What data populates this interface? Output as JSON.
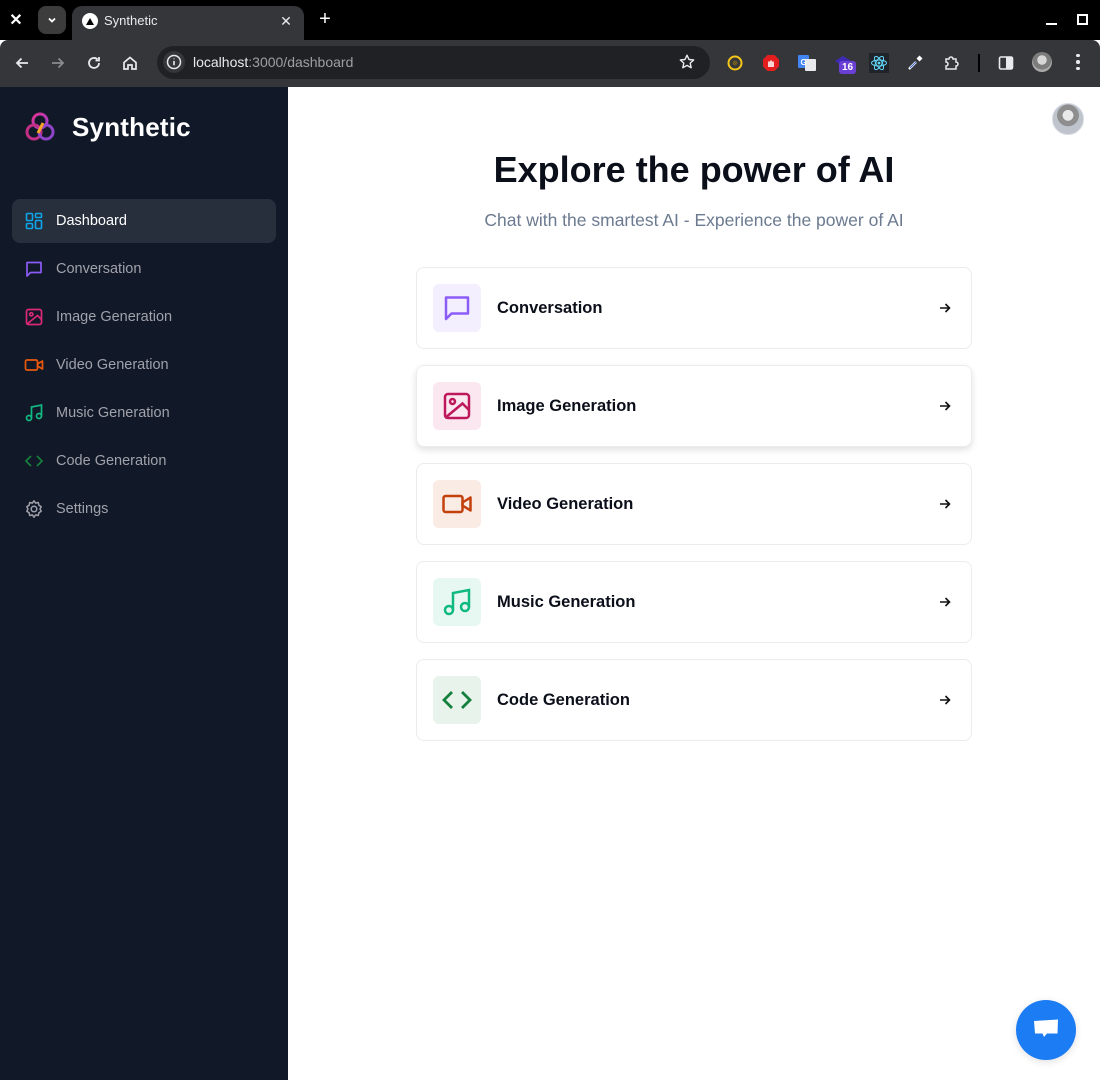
{
  "browser": {
    "tab_title": "Synthetic",
    "url_host": "localhost",
    "url_path": ":3000/dashboard",
    "extension_badge": "16"
  },
  "sidebar": {
    "brand_name": "Synthetic",
    "items": [
      {
        "label": "Dashboard",
        "icon": "layout-dashboard-icon",
        "color": "#0ea5e9",
        "active": true
      },
      {
        "label": "Conversation",
        "icon": "message-square-icon",
        "color": "#8b5cf6",
        "active": false
      },
      {
        "label": "Image Generation",
        "icon": "image-icon",
        "color": "#db2777",
        "active": false
      },
      {
        "label": "Video Generation",
        "icon": "video-icon",
        "color": "#ea580c",
        "active": false
      },
      {
        "label": "Music Generation",
        "icon": "music-icon",
        "color": "#10b981",
        "active": false
      },
      {
        "label": "Code Generation",
        "icon": "code-icon",
        "color": "#15803d",
        "active": false
      },
      {
        "label": "Settings",
        "icon": "settings-icon",
        "color": "#a1a1aa",
        "active": false
      }
    ]
  },
  "main": {
    "title": "Explore the power of AI",
    "subtitle": "Chat with the smartest AI - Experience the power of AI",
    "cards": [
      {
        "label": "Conversation",
        "icon": "message-square-icon",
        "color": "#8b5cf6",
        "bg": "#f3effe"
      },
      {
        "label": "Image Generation",
        "icon": "image-icon",
        "color": "#be185d",
        "bg": "#fbe7ef"
      },
      {
        "label": "Video Generation",
        "icon": "video-icon",
        "color": "#c2410c",
        "bg": "#fbebe5"
      },
      {
        "label": "Music Generation",
        "icon": "music-icon",
        "color": "#10b981",
        "bg": "#e7f8f2"
      },
      {
        "label": "Code Generation",
        "icon": "code-icon",
        "color": "#15803d",
        "bg": "#e8f3eb"
      }
    ]
  }
}
